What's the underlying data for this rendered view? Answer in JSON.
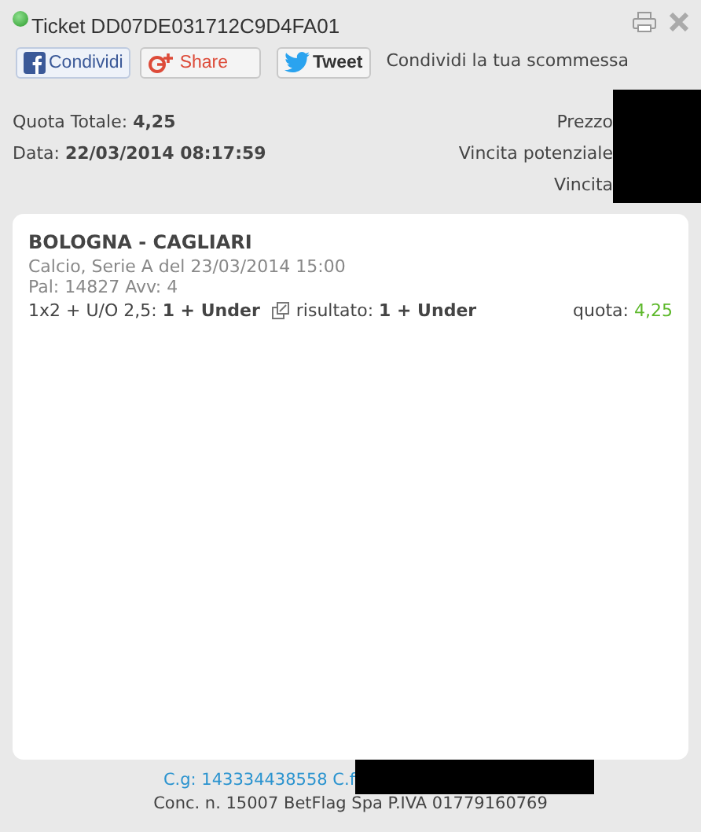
{
  "window": {
    "title": "Ticket DD07DE031712C9D4FA01"
  },
  "share_buttons": [
    {
      "kind": "facebook",
      "label": "Condividi"
    },
    {
      "kind": "googleplus",
      "label": "Share"
    },
    {
      "kind": "twitter",
      "label": "Tweet"
    }
  ],
  "share_caption": "Condividi la tua scommessa",
  "summary_left": [
    {
      "label": "Quota Totale:",
      "value": "4,25"
    },
    {
      "label": "Data:",
      "value": "22/03/2014 08:17:59"
    }
  ],
  "summary_right": [
    {
      "label": "Prezzo"
    },
    {
      "label": "Vincita potenziale"
    },
    {
      "label": "Vincita"
    }
  ],
  "events": [
    {
      "match": "BOLOGNA - CAGLIARI",
      "info": "Calcio, Serie A del 23/03/2014 15:00",
      "pal": "Pal: 14827 Avv: 4",
      "bet_label": "1x2 + U/O 2,5:",
      "bet_value": "1 + Under",
      "result_label": "risultato:",
      "result_value": "1 + Under",
      "odds_label": "quota:",
      "odds_value": "4,25"
    }
  ],
  "footer": {
    "codes": "C.g: 143334438558 C.f",
    "license": "Conc. n. 15007 BetFlag Spa P.IVA 01779160769"
  }
}
